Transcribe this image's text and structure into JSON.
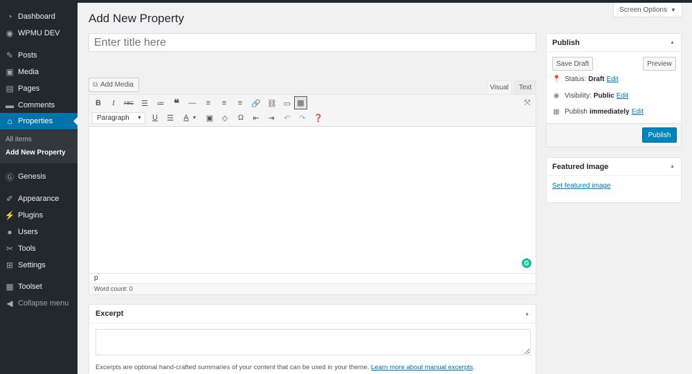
{
  "sidebar": {
    "items": [
      {
        "label": "Dashboard",
        "icon": "dashboard-icon"
      },
      {
        "label": "WPMU DEV",
        "icon": "wpmudev-icon"
      },
      {
        "label": "Posts",
        "icon": "pushpin-icon"
      },
      {
        "label": "Media",
        "icon": "media-icon"
      },
      {
        "label": "Pages",
        "icon": "pages-icon"
      },
      {
        "label": "Comments",
        "icon": "comments-icon"
      },
      {
        "label": "Properties",
        "icon": "home-icon"
      },
      {
        "label": "Genesis",
        "icon": "genesis-icon"
      },
      {
        "label": "Appearance",
        "icon": "paintbrush-icon"
      },
      {
        "label": "Plugins",
        "icon": "plugin-icon"
      },
      {
        "label": "Users",
        "icon": "users-icon"
      },
      {
        "label": "Tools",
        "icon": "wrench-icon"
      },
      {
        "label": "Settings",
        "icon": "settings-icon"
      },
      {
        "label": "Toolset",
        "icon": "toolset-icon"
      }
    ],
    "submenu": [
      "All items",
      "Add New Property"
    ],
    "collapse_label": "Collapse menu"
  },
  "header": {
    "title": "Add New Property",
    "screen_options": "Screen Options"
  },
  "title_field": {
    "placeholder": "Enter title here",
    "value": ""
  },
  "editor": {
    "add_media": "Add Media",
    "tab_visual": "Visual",
    "tab_text": "Text",
    "format_select": "Paragraph",
    "path": "p",
    "word_count": "Word count: 0",
    "grammarly": "G"
  },
  "excerpt": {
    "heading": "Excerpt",
    "help_text": "Excerpts are optional hand-crafted summaries of your content that can be used in your theme. ",
    "help_link": "Learn more about manual excerpts",
    "help_end": "."
  },
  "publish": {
    "heading": "Publish",
    "save_draft": "Save Draft",
    "preview": "Preview",
    "status_label": "Status:",
    "status_value": "Draft",
    "visibility_label": "Visibility:",
    "visibility_value": "Public",
    "publish_label": "Publish",
    "publish_value": "immediately",
    "edit": "Edit",
    "publish_button": "Publish"
  },
  "featured_image": {
    "heading": "Featured Image",
    "link": "Set featured image"
  },
  "colors": {
    "sidebar_bg": "#23282d",
    "accent": "#0073aa",
    "publish_button": "#0085ba",
    "grammarly": "#15c39a"
  }
}
